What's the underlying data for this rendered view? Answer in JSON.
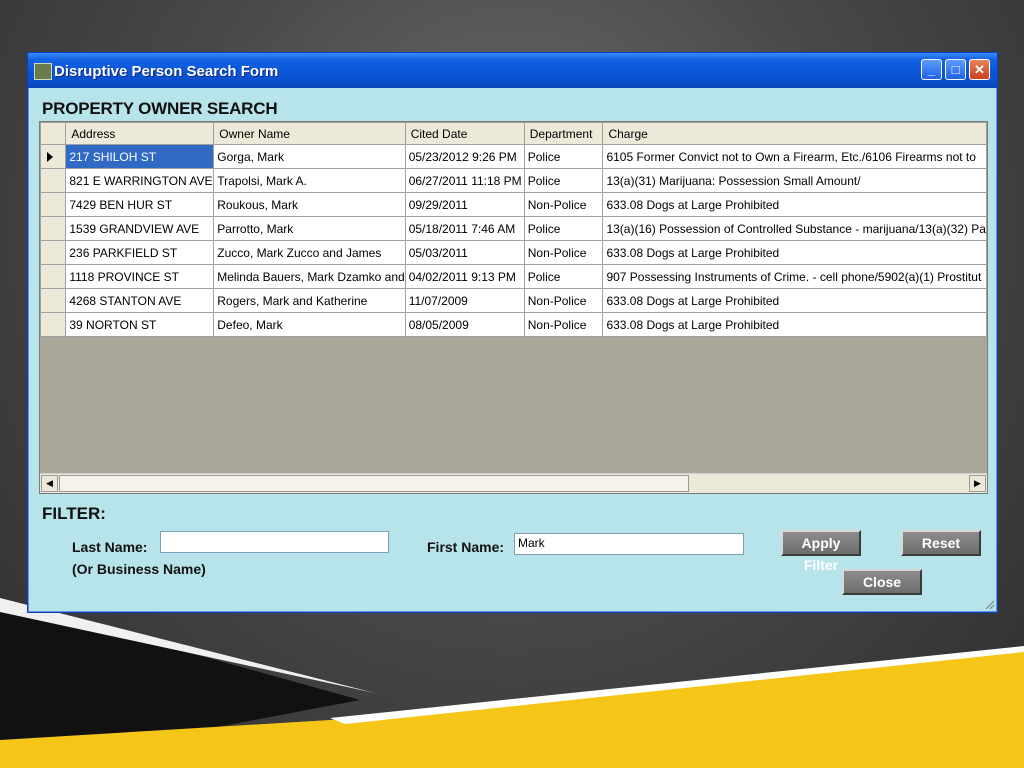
{
  "window": {
    "title": "Disruptive Person Search Form"
  },
  "section_title": "PROPERTY OWNER SEARCH",
  "table": {
    "columns": [
      "Address",
      "Owner Name",
      "Cited Date",
      "Department",
      "Charge"
    ],
    "rows": [
      {
        "address": "217 SHILOH ST",
        "owner": "Gorga, Mark",
        "cited": "05/23/2012 9:26 PM",
        "dept": "Police",
        "charge": "6105 Former Convict not to Own a Firearm, Etc./6106 Firearms not to"
      },
      {
        "address": "821 E WARRINGTON AVE",
        "owner": "Trapolsi, Mark A.",
        "cited": "06/27/2011 11:18 PM",
        "dept": "Police",
        "charge": "13(a)(31) Marijuana: Possession Small Amount/"
      },
      {
        "address": "7429 BEN HUR ST",
        "owner": "Roukous, Mark",
        "cited": "09/29/2011",
        "dept": "Non-Police",
        "charge": "633.08 Dogs at Large Prohibited"
      },
      {
        "address": "1539 GRANDVIEW AVE",
        "owner": "Parrotto, Mark",
        "cited": "05/18/2011 7:46 AM",
        "dept": "Police",
        "charge": "13(a)(16) Possession of Controlled Substance - marijuana/13(a)(32) Pa"
      },
      {
        "address": "236 PARKFIELD ST",
        "owner": "Zucco, Mark Zucco and James",
        "cited": "05/03/2011",
        "dept": "Non-Police",
        "charge": "633.08 Dogs at Large Prohibited"
      },
      {
        "address": "1118 PROVINCE ST",
        "owner": "Melinda Bauers, Mark Dzamko and",
        "cited": "04/02/2011 9:13 PM",
        "dept": "Police",
        "charge": "907 Possessing Instruments of Crime. - cell phone/5902(a)(1) Prostitut"
      },
      {
        "address": "4268 STANTON AVE",
        "owner": "Rogers, Mark and Katherine",
        "cited": "11/07/2009",
        "dept": "Non-Police",
        "charge": "633.08 Dogs at Large Prohibited"
      },
      {
        "address": "39 NORTON ST",
        "owner": "Defeo, Mark",
        "cited": "08/05/2009",
        "dept": "Non-Police",
        "charge": "633.08 Dogs at Large Prohibited"
      }
    ]
  },
  "filter": {
    "title": "FILTER:",
    "last_name_label": "Last Name:",
    "last_name_sublabel": "(Or Business Name)",
    "last_name_value": "",
    "first_name_label": "First Name:",
    "first_name_value": "Mark",
    "apply_label": "Apply Filter",
    "reset_label": "Reset",
    "close_label": "Close"
  },
  "icons": {
    "minimize": "minimize-icon",
    "maximize": "maximize-icon",
    "close": "close-icon",
    "row_selector": "row-selector-arrow-icon",
    "scroll_left": "scroll-left-icon",
    "scroll_right": "scroll-right-icon"
  },
  "colors": {
    "titlebar": "#0a57d8",
    "form_background": "#b7e4ea",
    "selected_cell": "#316ac5",
    "button": "#7a7a7a",
    "slide_accent": "#f5c518"
  }
}
